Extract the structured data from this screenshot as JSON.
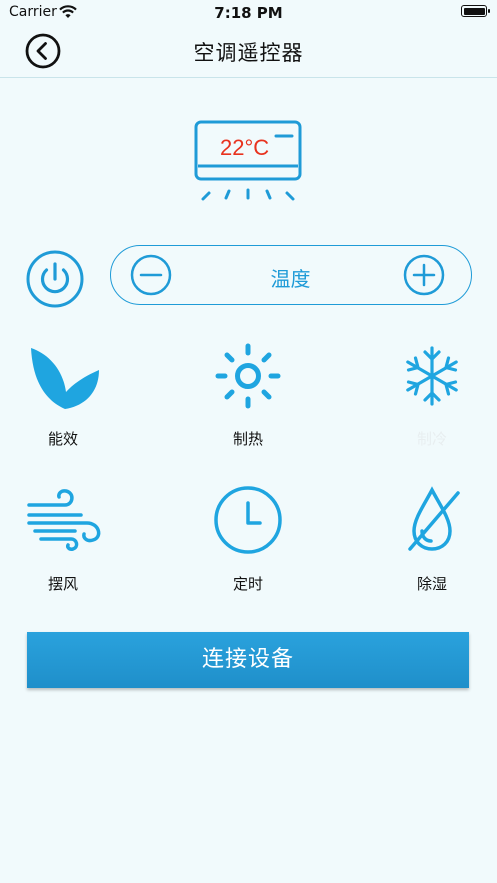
{
  "status_bar": {
    "carrier": "Carrier",
    "time": "7:18 PM"
  },
  "nav": {
    "title": "空调遥控器",
    "back_icon": "chevron-left-circle-icon"
  },
  "ac": {
    "temperature": "22°C"
  },
  "controls": {
    "temperature_label": "温度"
  },
  "functions": [
    {
      "label": "能效",
      "icon": "leaf-icon"
    },
    {
      "label": "制热",
      "icon": "sun-icon"
    },
    {
      "label": "制冷",
      "icon": "snowflake-icon"
    },
    {
      "label": "摆风",
      "icon": "wind-icon"
    },
    {
      "label": "定时",
      "icon": "clock-icon"
    },
    {
      "label": "除湿",
      "icon": "water-drop-off-icon"
    }
  ],
  "connect": {
    "label": "连接设备"
  },
  "colors": {
    "accent": "#1f9bd7",
    "temperature": "#e8321e",
    "background": "#f1fafc"
  }
}
